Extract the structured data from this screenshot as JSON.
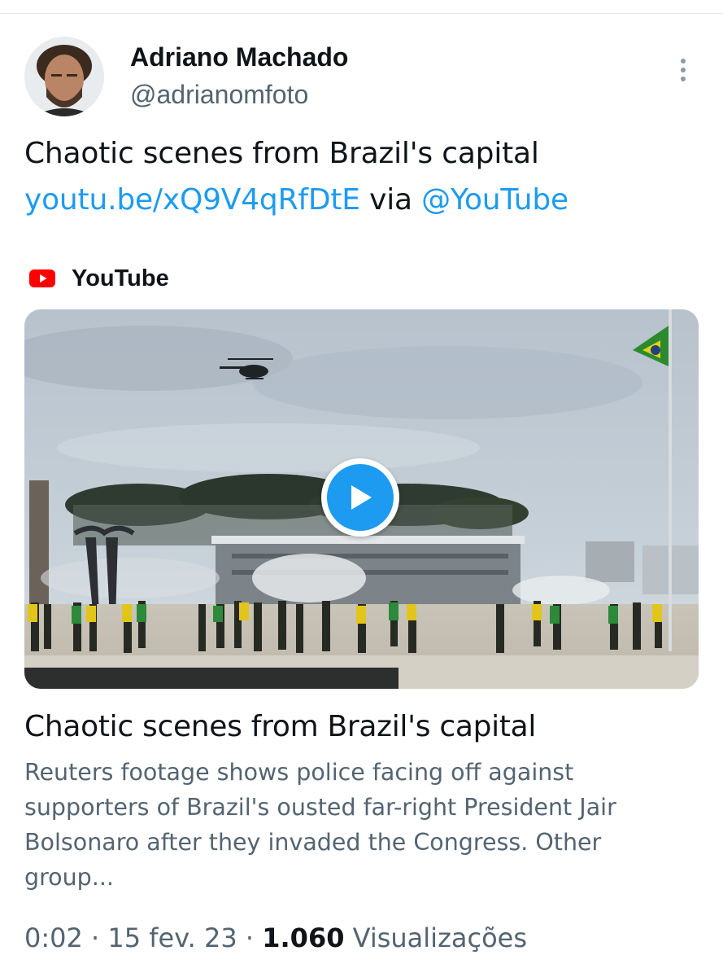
{
  "tweet": {
    "author": {
      "display_name": "Adriano Machado",
      "handle": "@adrianomfoto"
    },
    "text_plain": "Chaotic scenes from Brazil's capital",
    "link_text": "youtu.be/xQ9V4qRfDtE",
    "via_text": "via",
    "mention": "@YouTube",
    "more_icon": "more-vertical-icon"
  },
  "card": {
    "source_name": "YouTube",
    "source_icon": "youtube-logo-icon",
    "play_icon": "play-icon",
    "title": "Chaotic scenes from Brazil's capital",
    "description_lines": [
      "Reuters footage shows police facing off against",
      "supporters of Brazil's ousted far-right President Jair",
      "Bolsonaro after they invaded the Congress. Other",
      "group..."
    ]
  },
  "meta": {
    "time": "0:02",
    "separator": "·",
    "date": "15 fev. 23",
    "views_count": "1.060",
    "views_label": "Visualizações"
  },
  "colors": {
    "link": "#1d9bf0",
    "text": "#0f1419",
    "secondary_text": "#536471",
    "youtube_red": "#ff0000"
  }
}
